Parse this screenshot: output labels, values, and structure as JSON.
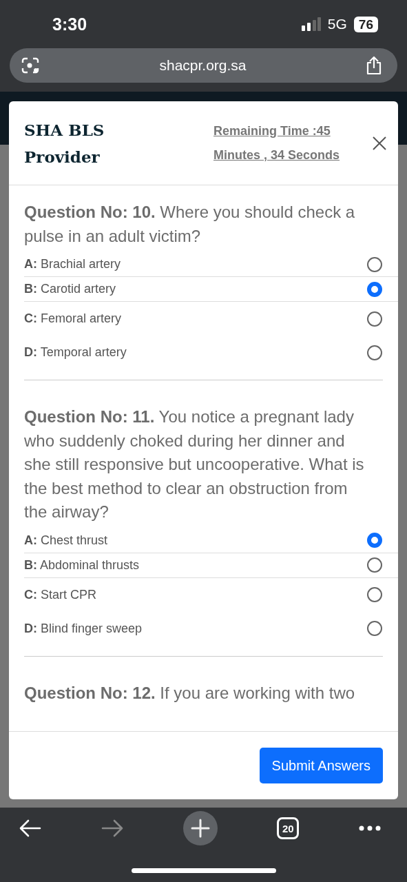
{
  "status_bar": {
    "time": "3:30",
    "network": "5G",
    "battery": "76"
  },
  "address_bar": {
    "url": "shacpr.org.sa"
  },
  "modal": {
    "title": "SHA BLS Provider",
    "timer": "Remaining Time :45 Minutes , 34 Seconds",
    "questions": [
      {
        "text": "**Question No: 10.** Where you should check a pulse in an adult victim?",
        "options": [
          {
            "text": "**A:** Brachial artery",
            "selected": false
          },
          {
            "text": "**B:** Carotid artery",
            "selected": true
          },
          {
            "text": "**C:** Femoral artery",
            "selected": false
          },
          {
            "text": "**D:** Temporal artery",
            "selected": false
          }
        ]
      },
      {
        "text": "**Question No: 11.** You notice a pregnant lady who suddenly choked during her dinner and she still responsive but uncooperative. What is the best method to clear an obstruction from the airway?",
        "options": [
          {
            "text": "**A:** Chest thrust",
            "selected": true
          },
          {
            "text": "**B:** Abdominal thrusts",
            "selected": false
          },
          {
            "text": "**C:** Start CPR",
            "selected": false
          },
          {
            "text": "**D:** Blind finger sweep",
            "selected": false
          }
        ]
      },
      {
        "text": "**Question No: 12.** If you are working with two"
      }
    ],
    "submit_button": "Submit Answers"
  },
  "toolbar": {
    "tab_count": "20"
  }
}
